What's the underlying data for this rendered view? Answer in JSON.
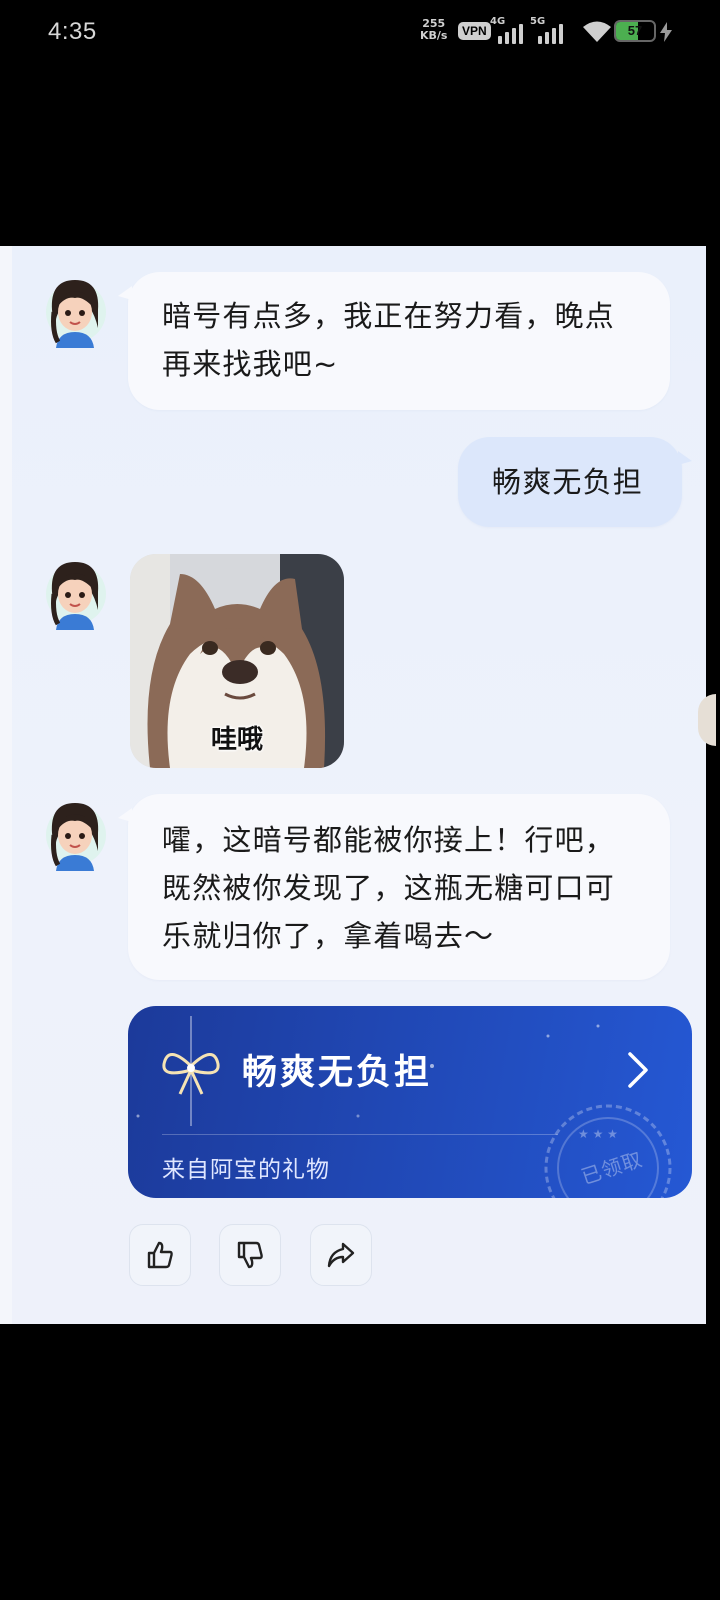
{
  "status_bar": {
    "time": "4:35",
    "net_speed_value": "255",
    "net_speed_unit": "KB/s",
    "vpn": "VPN",
    "sim1": "4G",
    "sim2": "5G",
    "battery": "57",
    "battery_level": 0.57,
    "accent": "#4caf50"
  },
  "chat": {
    "messages": [
      {
        "from": "bot",
        "text_line1": "暗号有点多，我正在努力看，晚点",
        "text_line2": "再来找我吧~"
      },
      {
        "from": "user",
        "text": "畅爽无负担"
      },
      {
        "from": "bot",
        "sticker_caption": "哇哦"
      },
      {
        "from": "bot",
        "text_line1": "嚯，这暗号都能被你接上！行吧，",
        "text_line2": "既然被你发现了，这瓶无糖可口可",
        "text_line3": "乐就归你了，拿着喝去～"
      }
    ],
    "gift_card": {
      "title": "畅爽无负担",
      "subtitle": "来自阿宝的礼物",
      "stamp": "已领取",
      "colors": {
        "start": "#1c3a9a",
        "end": "#2558d4"
      }
    },
    "actions": [
      {
        "icon": "thumbs-up-icon"
      },
      {
        "icon": "thumbs-down-icon"
      },
      {
        "icon": "share-icon"
      }
    ]
  }
}
